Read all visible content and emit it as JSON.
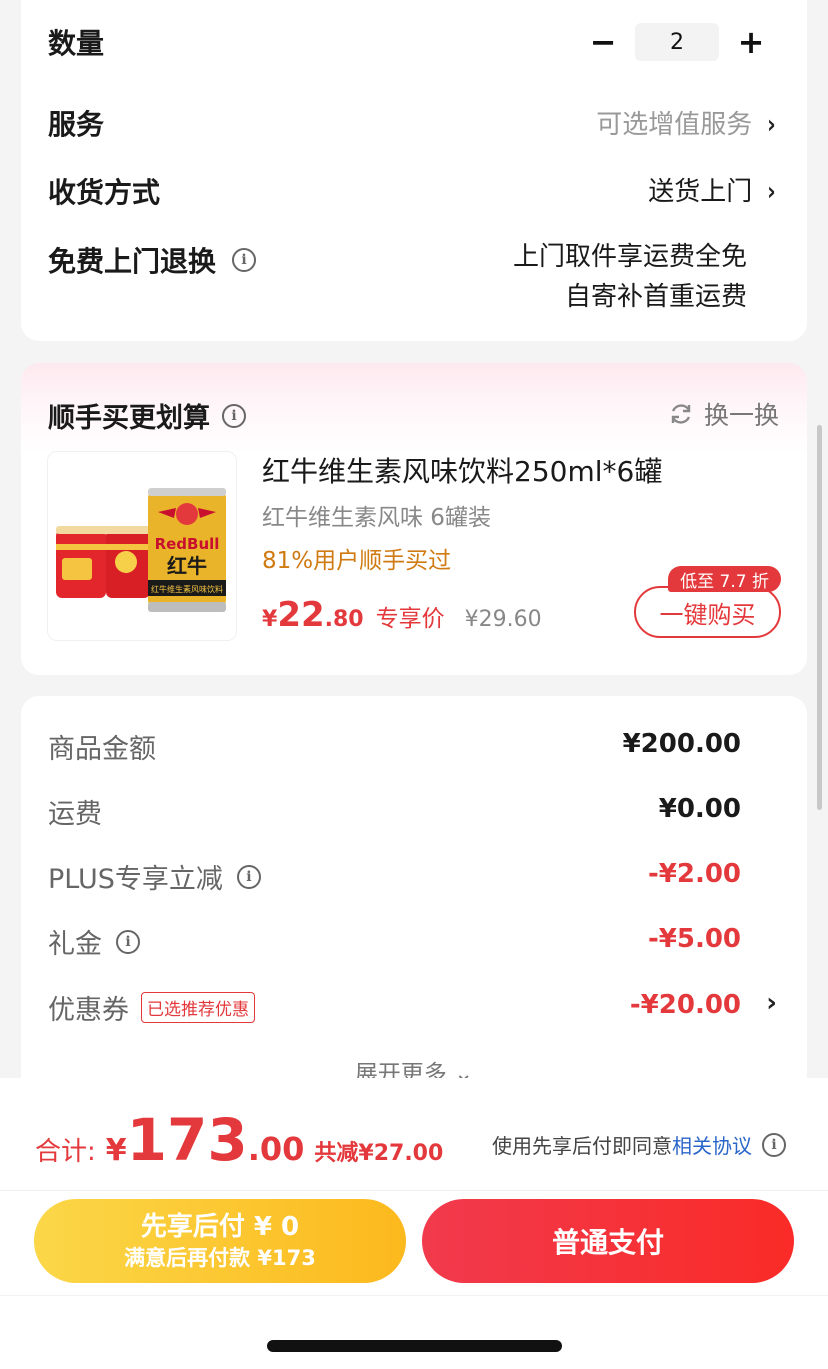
{
  "order_options": {
    "quantity": {
      "label": "数量",
      "value": "2",
      "minus": "−",
      "plus": "+"
    },
    "service": {
      "label": "服务",
      "value": "可选增值服务",
      "chevron": "›"
    },
    "delivery": {
      "label": "收货方式",
      "value": "送货上门",
      "chevron": "›"
    },
    "return": {
      "label": "免费上门退换",
      "info": "i",
      "line1": "上门取件享运费全免",
      "line2": "自寄补首重运费"
    }
  },
  "recommend": {
    "title": "顺手买更划算",
    "info": "i",
    "refresh_label": "换一换",
    "product": {
      "image_text_brand": "RedBull",
      "image_text_cn": "红牛",
      "image_text_band": "红牛维生素风味饮料",
      "name": "红牛维生素风味饮料250ml*6罐",
      "subtitle": "红牛维生素风味 6罐装",
      "stat": "81%用户顺手买过",
      "price_currency": "¥",
      "price_int": "22",
      "price_dec": ".80",
      "price_tag": "专享价",
      "price_old": "¥29.60",
      "discount_badge": "低至 7.7 折",
      "buy_label": "一键购买"
    }
  },
  "fees": {
    "goods": {
      "label": "商品金额",
      "value": "¥200.00"
    },
    "shipping": {
      "label": "运费",
      "value": "¥0.00"
    },
    "plus": {
      "label": "PLUS专享立减",
      "value": "-¥2.00"
    },
    "gift": {
      "label": "礼金",
      "value": "-¥5.00"
    },
    "coupon": {
      "label": "优惠券",
      "tag": "已选推荐优惠",
      "value": "-¥20.00",
      "chevron": "›"
    },
    "expand_label": "展开更多 ⌄"
  },
  "checkout": {
    "total_label": "合计:",
    "total_currency": "¥",
    "total_int": "173",
    "total_dec": ".00",
    "total_saving": "共减¥27.00",
    "agree_text": "使用先享后付即同意",
    "agree_link": "相关协议",
    "pay_later_line1": "先享后付 ¥ 0",
    "pay_later_line2": "满意后再付款 ¥173",
    "pay_normal_label": "普通支付"
  },
  "colors": {
    "accent_red": "#e4393c",
    "stat_orange": "#d07a12",
    "link_blue": "#2a66c9",
    "pay_later_yellow": "#fcc22c",
    "pay_normal_red": "#f5323c"
  }
}
